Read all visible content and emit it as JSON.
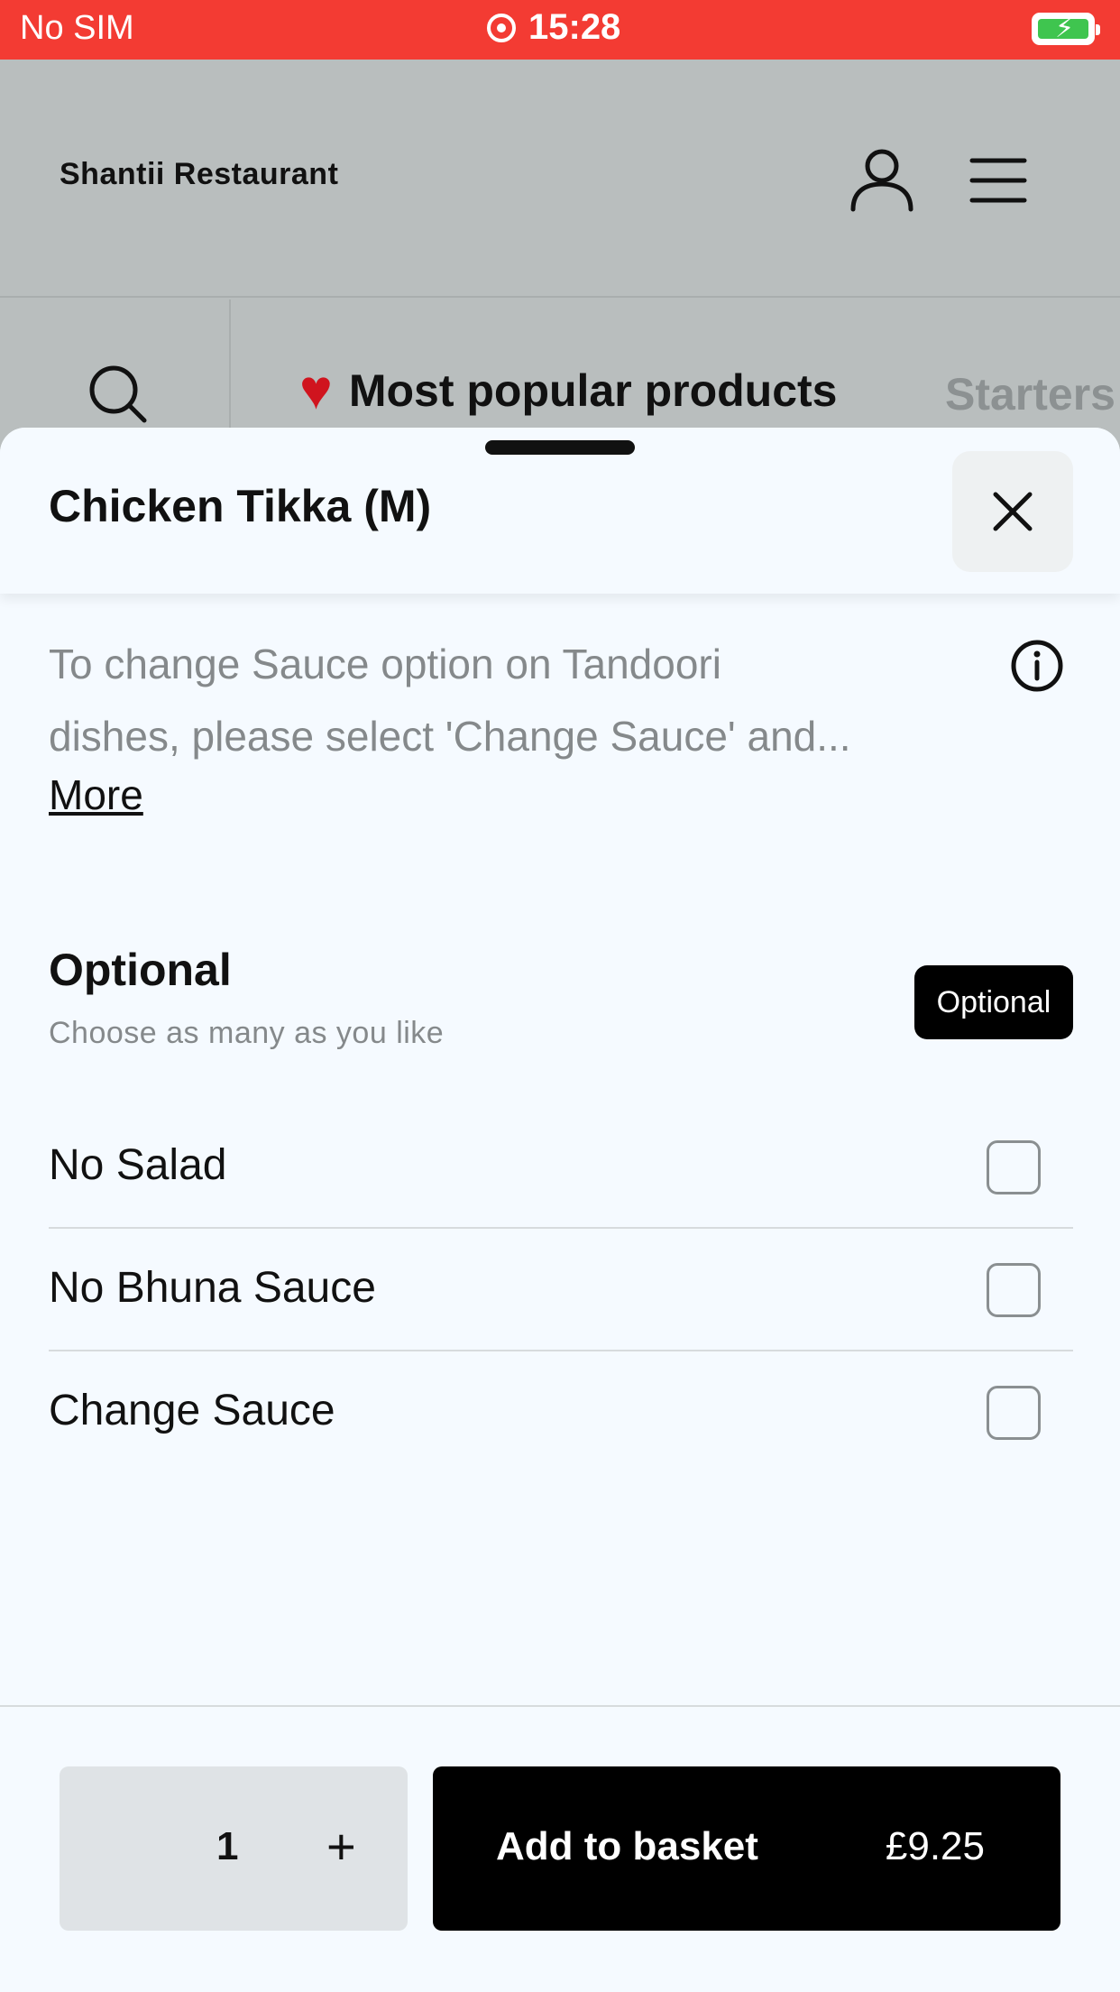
{
  "status_bar": {
    "carrier": "No SIM",
    "time": "15:28",
    "icons": [
      "screen-record-icon",
      "battery-charging-icon"
    ],
    "color": "#f33b33"
  },
  "app": {
    "brand": "Shantii Restaurant",
    "icons": [
      "user-icon",
      "menu-icon",
      "search-icon"
    ],
    "categories": {
      "active": "Most popular products",
      "next": "Starters"
    }
  },
  "sheet": {
    "title": "Chicken Tikka (M)",
    "description_lines": [
      "To change Sauce option on Tandoori",
      "dishes, please select 'Change Sauce' and..."
    ],
    "more_link": "More",
    "group": {
      "title": "Optional",
      "subtitle": "Choose as many as you like",
      "badge": "Optional",
      "options": [
        {
          "label": "No Salad",
          "checked": false
        },
        {
          "label": "No Bhuna Sauce",
          "checked": false
        },
        {
          "label": "Change Sauce",
          "checked": false
        }
      ]
    }
  },
  "footer": {
    "quantity": "1",
    "plus_label": "+",
    "add_label": "Add to basket",
    "price": "£9.25"
  }
}
